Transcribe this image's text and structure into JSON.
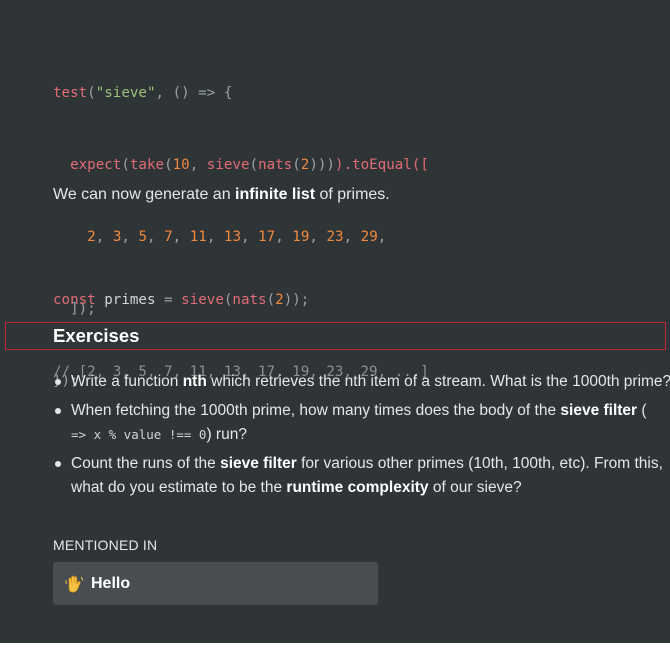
{
  "top_brace": "}",
  "test_code": {
    "test_fn": "test",
    "test_name": "\"sieve\"",
    "arrow_open": ", () => {",
    "expect_fn": "expect",
    "take_fn": "take",
    "ten": "10",
    "sieve_fn": "sieve",
    "nats_fn": "nats",
    "two": "2",
    "to_equal": ").toEqual([",
    "nums": [
      "2",
      "3",
      "5",
      "7",
      "11",
      "13",
      "17",
      "19",
      "23",
      "29"
    ],
    "close_arr": "]);",
    "close_test": "});"
  },
  "paragraph": {
    "before": "We can now generate an ",
    "bold": "infinite list",
    "after": " of primes."
  },
  "primes_code": {
    "const_kw": "const",
    "var_name": " primes ",
    "eq": "=",
    "sieve_fn": "sieve",
    "nats_fn": "nats",
    "two": "2",
    "comment": "// [2, 3, 5, 7, 11, 13, 17, 19, 23, 29, ...]"
  },
  "exercises": {
    "heading": "Exercises",
    "items": [
      {
        "pre": "Write a function ",
        "bold": "nth",
        "post": " which retrieves the nth item of a stream. What is the 1000th prime?"
      },
      {
        "pre": "When fetching the 1000th prime, how many times does the body of the ",
        "bold": "sieve filter",
        "post": " (",
        "code": "=> x % value !== 0",
        "post2": ") run?"
      },
      {
        "pre": "Count the runs of the ",
        "bold": "sieve filter",
        "post": " for various other primes (10th, 100th, etc). From this,",
        "line2_pre": "what do you estimate to be the ",
        "line2_bold": "runtime complexity",
        "line2_post": " of our sieve?"
      }
    ]
  },
  "mentioned": {
    "label": "MENTIONED IN",
    "card_title": "Hello",
    "card_icon": "waving-hand-icon"
  }
}
